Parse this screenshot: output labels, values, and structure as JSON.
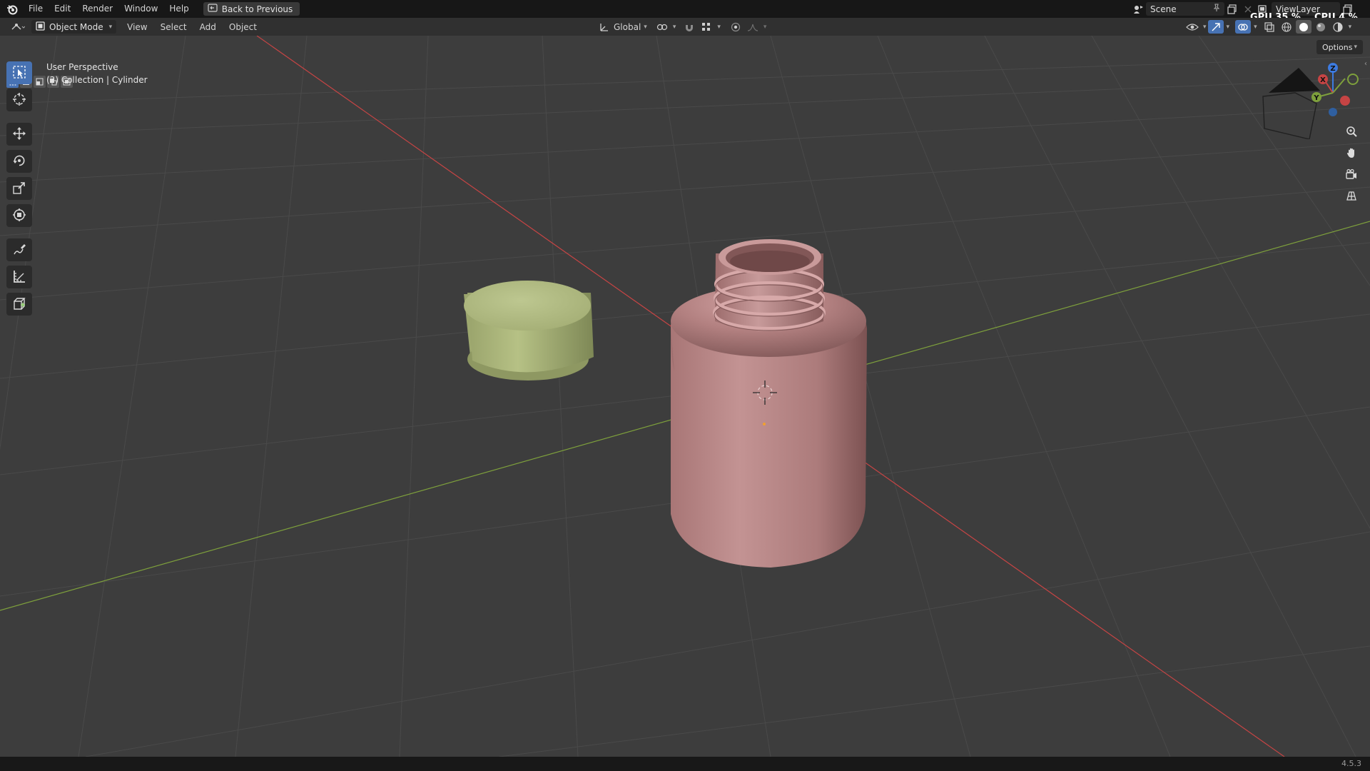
{
  "topbar": {
    "menus": [
      "File",
      "Edit",
      "Render",
      "Window",
      "Help"
    ],
    "back_label": "Back to Previous",
    "scene_label": "Scene",
    "viewlayer_label": "ViewLayer",
    "gpu_stat": "GPU 35 %",
    "cpu_stat": "CPU 4 %"
  },
  "header": {
    "mode_label": "Object Mode",
    "menus": [
      "View",
      "Select",
      "Add",
      "Object"
    ],
    "orientation_label": "Global"
  },
  "viewport": {
    "perspective_label": "User Perspective",
    "collection_label": "(2) Collection | Cylinder",
    "options_label": "Options",
    "gizmo_labels": {
      "x": "X",
      "y": "Y",
      "z": "Z"
    }
  },
  "toolbar": {
    "tools": [
      "select-box",
      "cursor",
      "move",
      "rotate",
      "scale",
      "transform",
      "annotate",
      "measure",
      "add-cube"
    ],
    "active_tool": "select-box"
  },
  "status": {
    "version": "4.5.3"
  },
  "colors": {
    "bottle": "#b68383",
    "cap": "#a9b57c",
    "x_axis": "#c64444",
    "y_axis": "#7ea03c",
    "accent": "#4772b3"
  }
}
